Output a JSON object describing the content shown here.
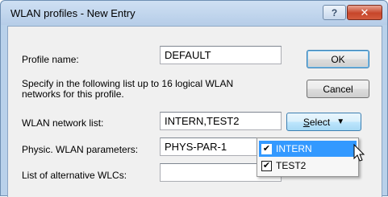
{
  "window": {
    "title": "WLAN profiles - New Entry",
    "help_label": "?",
    "close_label": "✕"
  },
  "form": {
    "profile_name_label": "Profile name:",
    "profile_name_value": "DEFAULT",
    "description_line1": "Specify in the following list up to 16 logical WLAN",
    "description_line2": "networks for this profile.",
    "wlan_list_label": "WLAN network list:",
    "wlan_list_value": "INTERN,TEST2",
    "physic_label": "Physic. WLAN parameters:",
    "physic_value": "PHYS-PAR-1",
    "alt_wlc_label": "List of alternative WLCs:",
    "alt_wlc_value": ""
  },
  "buttons": {
    "ok": "OK",
    "cancel": "Cancel",
    "select_accel": "S",
    "select_rest": "elect",
    "select_caret": "▼"
  },
  "dropdown": {
    "items": [
      {
        "label": "INTERN",
        "checked": true,
        "highlighted": true
      },
      {
        "label": "TEST2",
        "checked": true,
        "highlighted": false
      }
    ],
    "check_glyph": "✔"
  }
}
